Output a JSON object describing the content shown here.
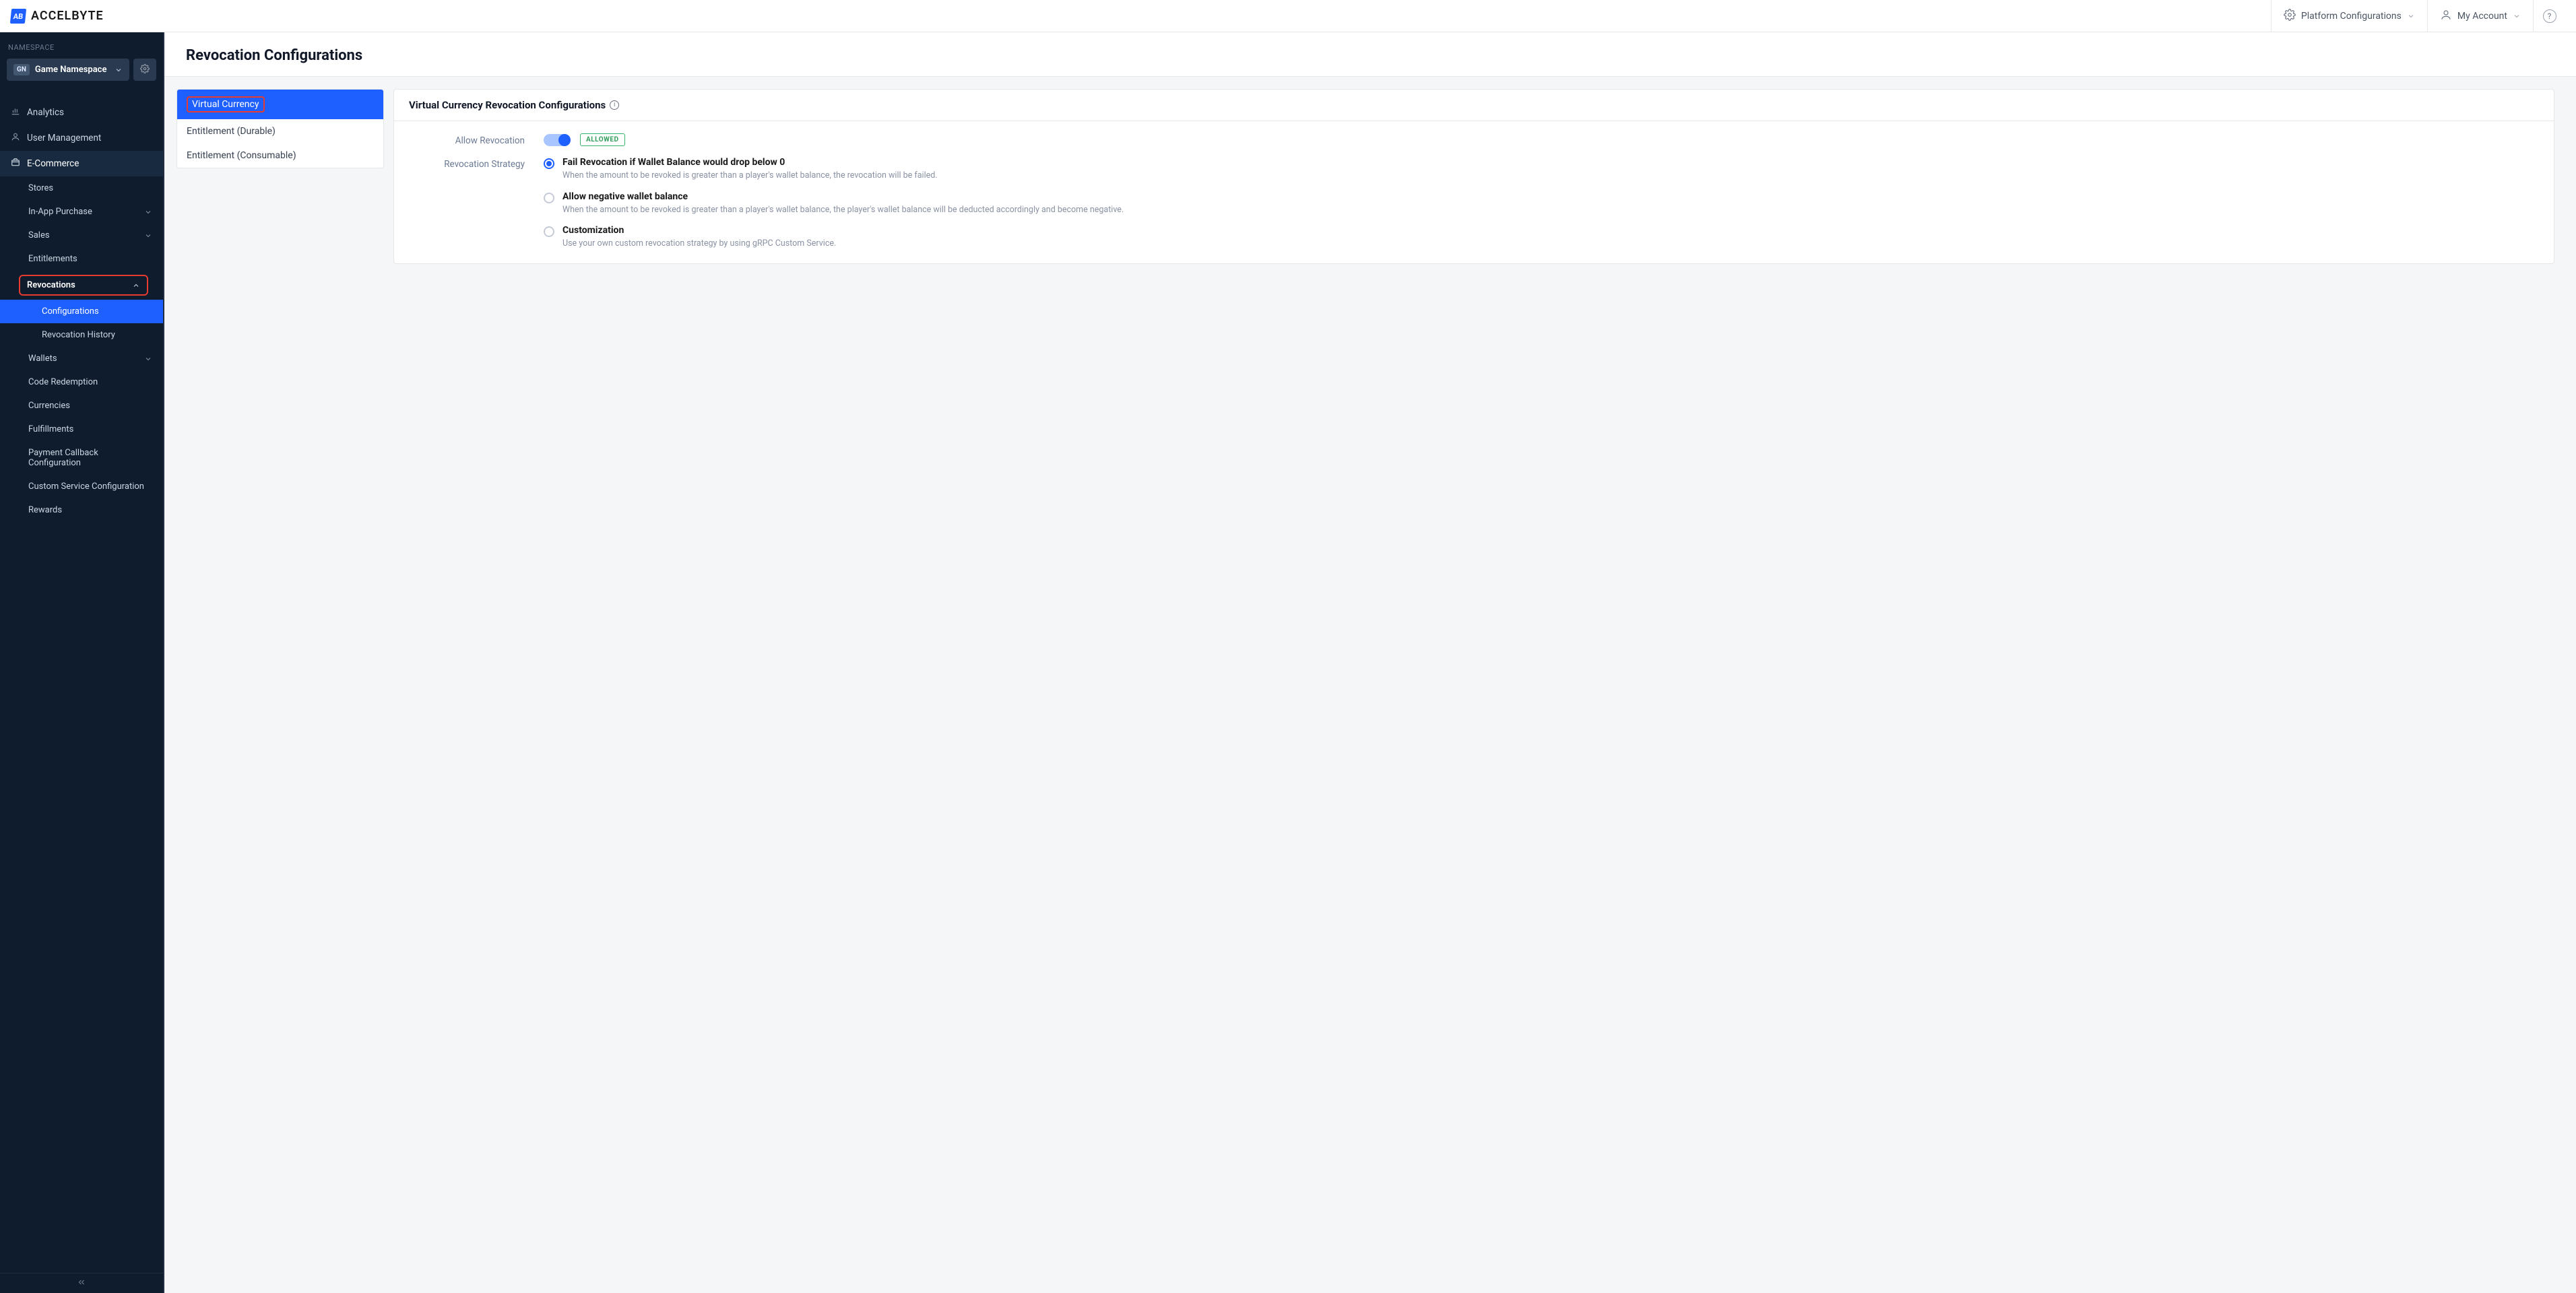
{
  "brand": {
    "logo_initials": "AB",
    "name": "ACCELBYTE"
  },
  "topbar": {
    "platform_configs": "Platform Configurations",
    "my_account": "My Account"
  },
  "sidebar": {
    "namespace_label": "NAMESPACE",
    "namespace_badge": "GN",
    "namespace_name": "Game Namespace",
    "items": {
      "analytics": "Analytics",
      "user_management": "User Management",
      "ecommerce": "E-Commerce",
      "stores": "Stores",
      "in_app_purchase": "In-App Purchase",
      "sales": "Sales",
      "entitlements": "Entitlements",
      "revocations": "Revocations",
      "configurations": "Configurations",
      "revocation_history": "Revocation History",
      "wallets": "Wallets",
      "code_redemption": "Code Redemption",
      "currencies": "Currencies",
      "fulfillments": "Fulfillments",
      "payment_callback_config": "Payment Callback Configuration",
      "custom_service_config": "Custom Service Configuration",
      "rewards": "Rewards"
    }
  },
  "page": {
    "title": "Revocation Configurations"
  },
  "tabs": {
    "virtual_currency": "Virtual Currency",
    "entitlement_durable": "Entitlement (Durable)",
    "entitlement_consumable": "Entitlement (Consumable)"
  },
  "panel": {
    "title": "Virtual Currency Revocation Configurations",
    "allow_revocation_label": "Allow Revocation",
    "allowed_badge": "ALLOWED",
    "revocation_strategy_label": "Revocation Strategy",
    "strategies": [
      {
        "title": "Fail Revocation if Wallet Balance would drop below 0",
        "desc": "When the amount to be revoked is greater than a player's wallet balance, the revocation will be failed.",
        "selected": true
      },
      {
        "title": "Allow negative wallet balance",
        "desc": "When the amount to be revoked is greater than a player's wallet balance, the player's wallet balance will be deducted accordingly and become negative.",
        "selected": false
      },
      {
        "title": "Customization",
        "desc": "Use your own custom revocation strategy by using gRPC Custom Service.",
        "selected": false
      }
    ]
  }
}
